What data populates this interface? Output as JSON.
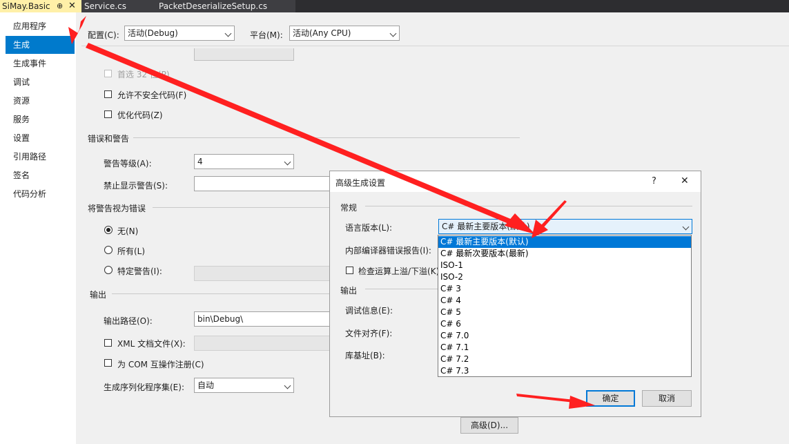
{
  "tabs": [
    {
      "label": "SiMay.Basic",
      "active": true
    },
    {
      "label": "Service.cs",
      "active": false
    },
    {
      "label": "PacketDeserializeSetup.cs",
      "active": false
    }
  ],
  "tab_icons": {
    "pin": "⊕",
    "close": "✕"
  },
  "sidebar": {
    "items": [
      "应用程序",
      "生成",
      "生成事件",
      "调试",
      "资源",
      "服务",
      "设置",
      "引用路径",
      "签名",
      "代码分析"
    ],
    "selected_index": 1
  },
  "config": {
    "config_label": "配置(C):",
    "config_value": "活动(Debug)",
    "platform_label": "平台(M):",
    "platform_value": "活动(Any CPU)"
  },
  "general": {
    "prefer32_label": "首选 32 位(P)",
    "unsafe_label": "允许不安全代码(F)",
    "optimize_label": "优化代码(Z)"
  },
  "errors": {
    "section_label": "错误和警告",
    "warning_level_label": "警告等级(A):",
    "warning_level_value": "4",
    "suppress_label": "禁止显示警告(S):",
    "suppress_value": ""
  },
  "treat_warnings": {
    "section_label": "将警告视为错误",
    "none_label": "无(N)",
    "all_label": "所有(L)",
    "specific_label": "特定警告(I):",
    "selected": "none"
  },
  "output": {
    "section_label": "输出",
    "path_label": "输出路径(O):",
    "path_value": "bin\\Debug\\",
    "xml_label": "XML 文档文件(X):",
    "com_label": "为 COM 互操作注册(C)",
    "serialize_label": "生成序列化程序集(E):",
    "serialize_value": "自动"
  },
  "advanced_button": "高级(D)...",
  "dialog": {
    "title": "高级生成设置",
    "help": "?",
    "close": "✕",
    "general_section": "常规",
    "lang_version_label": "语言版本(L):",
    "lang_version_value": "C# 最新主要版本(默认)",
    "internal_error_label": "内部编译器错误报告(I):",
    "overflow_label": "检查运算上溢/下溢(K)",
    "output_section": "输出",
    "debug_info_label": "调试信息(E):",
    "file_align_label": "文件对齐(F):",
    "base_addr_label": "库基址(B):",
    "ok_button": "确定",
    "cancel_button": "取消",
    "lang_options": [
      "C# 最新主要版本(默认)",
      "C# 最新次要版本(最新)",
      "ISO-1",
      "ISO-2",
      "C# 3",
      "C# 4",
      "C# 5",
      "C# 6",
      "C# 7.0",
      "C# 7.1",
      "C# 7.2",
      "C# 7.3"
    ],
    "highlighted_option": 0
  },
  "colors": {
    "accent": "#007acc",
    "annotation_arrow": "#ff2020",
    "tab_active": "#fff0a8"
  }
}
